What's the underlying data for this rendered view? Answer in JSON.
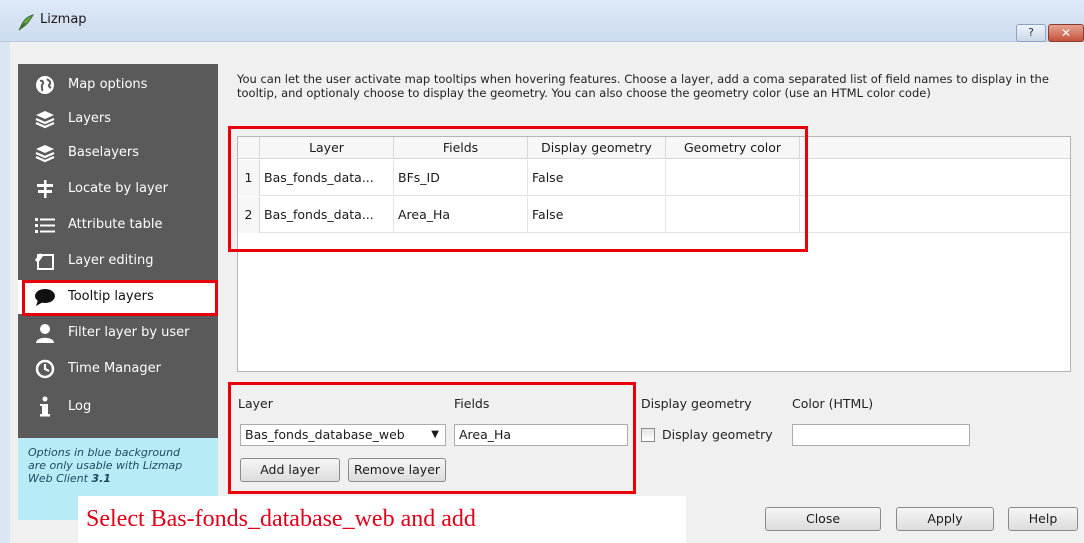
{
  "window": {
    "title": "Lizmap",
    "help_button": "?",
    "close_button": "✕"
  },
  "sidebar": {
    "items": [
      {
        "label": "Map options",
        "icon": "globe-icon"
      },
      {
        "label": "Layers",
        "icon": "layers-icon"
      },
      {
        "label": "Baselayers",
        "icon": "baselayers-icon"
      },
      {
        "label": "Locate by layer",
        "icon": "signpost-icon"
      },
      {
        "label": "Attribute table",
        "icon": "list-icon"
      },
      {
        "label": "Layer editing",
        "icon": "edit-icon"
      },
      {
        "label": "Tooltip layers",
        "icon": "speech-bubble-icon",
        "selected": true
      },
      {
        "label": "Filter layer by user",
        "icon": "user-icon"
      },
      {
        "label": "Time Manager",
        "icon": "clock-icon"
      },
      {
        "label": "Log",
        "icon": "info-icon"
      }
    ],
    "note_line1": "Options in blue background",
    "note_line2": "are only usable with Lizmap",
    "note_line3": "Web Client",
    "note_version": "3.1"
  },
  "description": "You can let the user activate map tooltips when hovering features. Choose a layer, add a coma separated list of field names to display in the tooltip, and optionaly choose to display the geometry. You can also choose the geometry color (use an HTML color code)",
  "table": {
    "columns": [
      "Layer",
      "Fields",
      "Display geometry",
      "Geometry color"
    ],
    "rows": [
      {
        "num": "1",
        "layer": "Bas_fonds_data...",
        "fields": "BFs_ID",
        "display_geometry": "False",
        "geometry_color": ""
      },
      {
        "num": "2",
        "layer": "Bas_fonds_data...",
        "fields": "Area_Ha",
        "display_geometry": "False",
        "geometry_color": ""
      }
    ]
  },
  "form": {
    "layer_label": "Layer",
    "fields_label": "Fields",
    "display_geometry_label": "Display geometry",
    "color_label": "Color (HTML)",
    "layer_select_value": "Bas_fonds_database_web",
    "fields_value": "Area_Ha",
    "display_geometry_checkbox_label": "Display geometry",
    "display_geometry_checked": false,
    "color_value": "",
    "add_layer_button": "Add layer",
    "remove_layer_button": "Remove layer"
  },
  "footer": {
    "close_button": "Close",
    "apply_button": "Apply",
    "help_button": "Help"
  },
  "annotation": {
    "text": "Select Bas-fonds_database_web and add",
    "color": "#e0001a"
  },
  "colors": {
    "highlight_red": "#e8000b",
    "sidebar_bg": "#5a5a5a",
    "note_bg": "#b7ecf7"
  }
}
